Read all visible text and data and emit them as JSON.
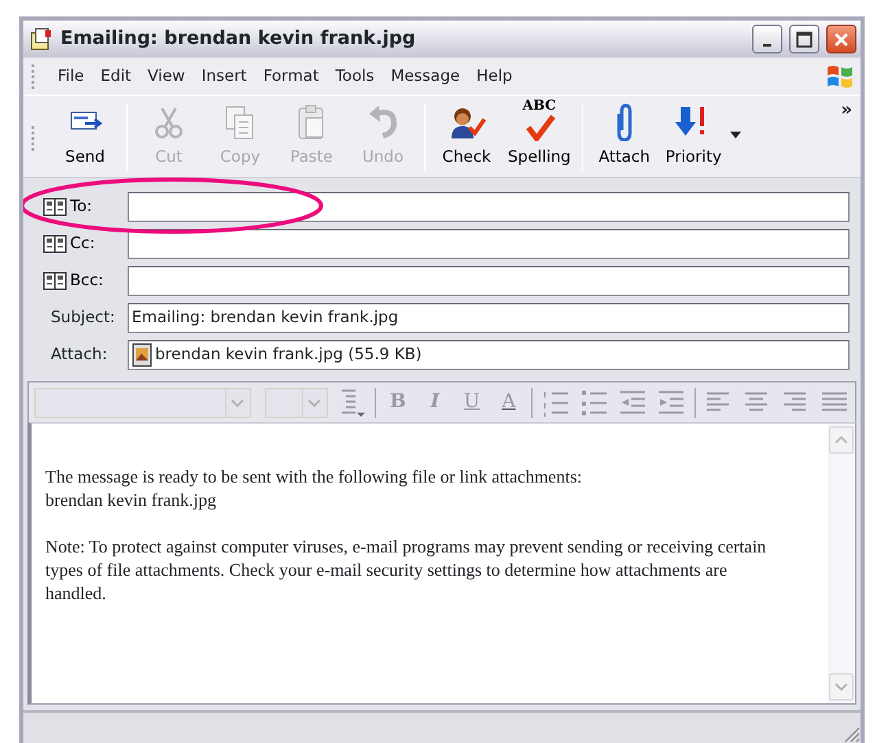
{
  "window": {
    "title": "Emailing: brendan kevin frank.jpg"
  },
  "menu": [
    {
      "label": "File"
    },
    {
      "label": "Edit"
    },
    {
      "label": "View"
    },
    {
      "label": "Insert"
    },
    {
      "label": "Format"
    },
    {
      "label": "Tools"
    },
    {
      "label": "Message"
    },
    {
      "label": "Help"
    }
  ],
  "toolbar": [
    {
      "kind": "send",
      "label": "Send",
      "disabled": false,
      "group_end": true
    },
    {
      "kind": "cut",
      "label": "Cut",
      "disabled": true,
      "group_end": false
    },
    {
      "kind": "copy",
      "label": "Copy",
      "disabled": true,
      "group_end": false
    },
    {
      "kind": "paste",
      "label": "Paste",
      "disabled": true,
      "group_end": false
    },
    {
      "kind": "undo",
      "label": "Undo",
      "disabled": true,
      "group_end": true
    },
    {
      "kind": "check",
      "label": "Check",
      "disabled": false,
      "group_end": false
    },
    {
      "kind": "spelling",
      "label": "Spelling",
      "icon_text": "ABC",
      "disabled": false,
      "group_end": true
    },
    {
      "kind": "attach",
      "label": "Attach",
      "disabled": false,
      "group_end": false
    },
    {
      "kind": "priority",
      "label": "Priority",
      "disabled": false,
      "group_end": false
    }
  ],
  "toolbar_more": "»",
  "fields": [
    {
      "kind": "address",
      "label": "To:"
    },
    {
      "kind": "address",
      "label": "Cc:"
    },
    {
      "kind": "address",
      "label": "Bcc:"
    },
    {
      "kind": "text",
      "label": "Subject:",
      "value": "Emailing: brendan kevin frank.jpg"
    },
    {
      "kind": "attachment",
      "label": "Attach:",
      "value": "brendan kevin frank.jpg (55.9 KB)"
    }
  ],
  "format_toolbar": [
    {
      "kind": "font-select"
    },
    {
      "kind": "size-select"
    },
    {
      "kind": "paragraph-style"
    },
    {
      "kind": "separator"
    },
    {
      "kind": "bold",
      "text": "B"
    },
    {
      "kind": "italic",
      "text": "I"
    },
    {
      "kind": "underline",
      "text": "U"
    },
    {
      "kind": "font-color",
      "text": "A"
    },
    {
      "kind": "separator"
    },
    {
      "kind": "numbered-list"
    },
    {
      "kind": "bullet-list"
    },
    {
      "kind": "outdent"
    },
    {
      "kind": "indent"
    },
    {
      "kind": "separator"
    },
    {
      "kind": "align-left"
    },
    {
      "kind": "align-center"
    },
    {
      "kind": "align-right"
    },
    {
      "kind": "justify"
    }
  ],
  "body": {
    "paragraphs": [
      [
        "The message is ready to be sent with the following file or link attachments:",
        "brendan kevin frank.jpg"
      ],
      [
        "Note: To protect against computer viruses, e-mail programs may prevent sending or receiving certain types of file attachments.  Check your e-mail security settings to determine how attachments are handled."
      ]
    ]
  },
  "annotation": {
    "kind": "ellipse"
  }
}
